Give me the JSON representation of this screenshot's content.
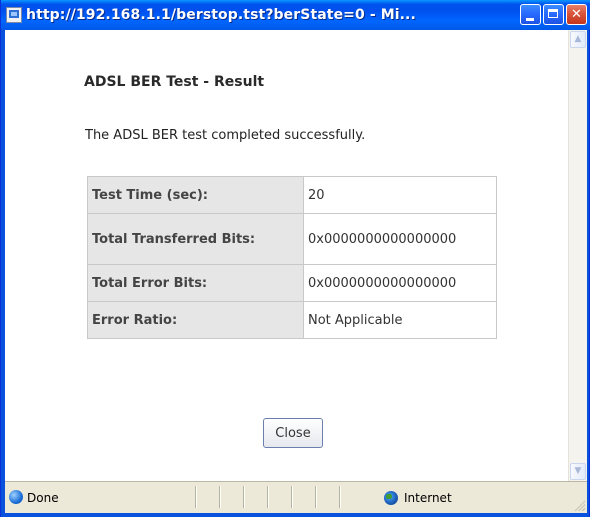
{
  "window": {
    "title": "http://192.168.1.1/berstop.tst?berState=0 - Mi..."
  },
  "page": {
    "heading": "ADSL BER Test - Result",
    "message": "The ADSL BER test completed successfully.",
    "rows": [
      {
        "label": "Test Time (sec):",
        "value": "20"
      },
      {
        "label": "Total Transferred Bits:",
        "value": "0x0000000000000000"
      },
      {
        "label": "Total Error Bits:",
        "value": "0x0000000000000000"
      },
      {
        "label": "Error Ratio:",
        "value": "Not Applicable"
      }
    ],
    "close_label": "Close"
  },
  "statusbar": {
    "status": "Done",
    "zone": "Internet"
  },
  "icons": {
    "window": "ie-window-icon",
    "minimize": "minimize-icon",
    "maximize": "maximize-icon",
    "close": "close-icon",
    "status": "ie-page-icon",
    "zone": "internet-zone-icon"
  },
  "colors": {
    "titlebar": "#0058e6",
    "close_button": "#d8553b",
    "table_label_bg": "#e6e6e6",
    "window_bg": "#ffffff"
  }
}
